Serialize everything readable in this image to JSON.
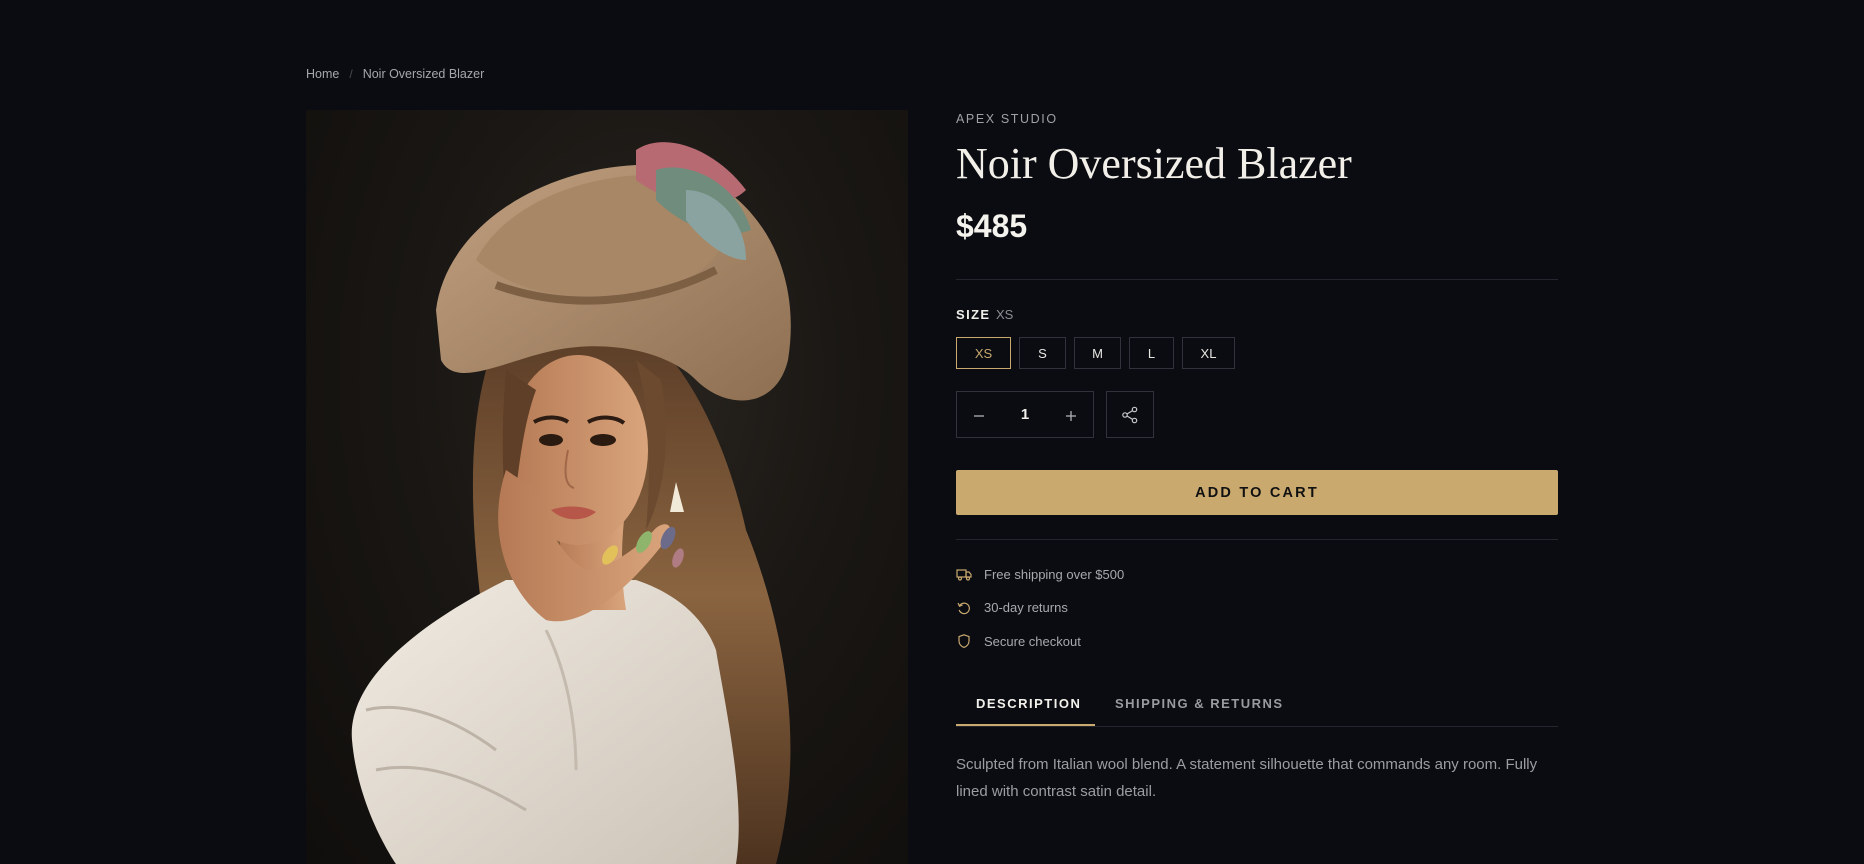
{
  "breadcrumb": {
    "home": "Home",
    "separator": "/",
    "current": "Noir Oversized Blazer"
  },
  "product": {
    "brand": "APEX STUDIO",
    "title": "Noir Oversized Blazer",
    "price": "$485",
    "image_alt": "Woman in a tan wide-brim hat with feathers and a white shirt, hand resting on cheek"
  },
  "size": {
    "label": "SIZE",
    "selected": "XS",
    "options": [
      "XS",
      "S",
      "M",
      "L",
      "XL"
    ]
  },
  "quantity": {
    "value": "1",
    "decrement": "−",
    "increment": "+"
  },
  "actions": {
    "add_to_cart": "ADD TO CART",
    "share_icon": "share-icon"
  },
  "perks": [
    {
      "icon": "truck-icon",
      "text": "Free shipping over $500"
    },
    {
      "icon": "return-icon",
      "text": "30-day returns"
    },
    {
      "icon": "shield-icon",
      "text": "Secure checkout"
    }
  ],
  "tabs": {
    "items": [
      "DESCRIPTION",
      "SHIPPING & RETURNS"
    ],
    "active": "DESCRIPTION"
  },
  "description": "Sculpted from Italian wool blend. A statement silhouette that commands any room. Fully lined with contrast satin detail.",
  "colors": {
    "background": "#0a0c12",
    "accent": "#c9a96e",
    "text": "#f2efe9",
    "muted": "#a0a1a7",
    "border": "#30333c"
  }
}
